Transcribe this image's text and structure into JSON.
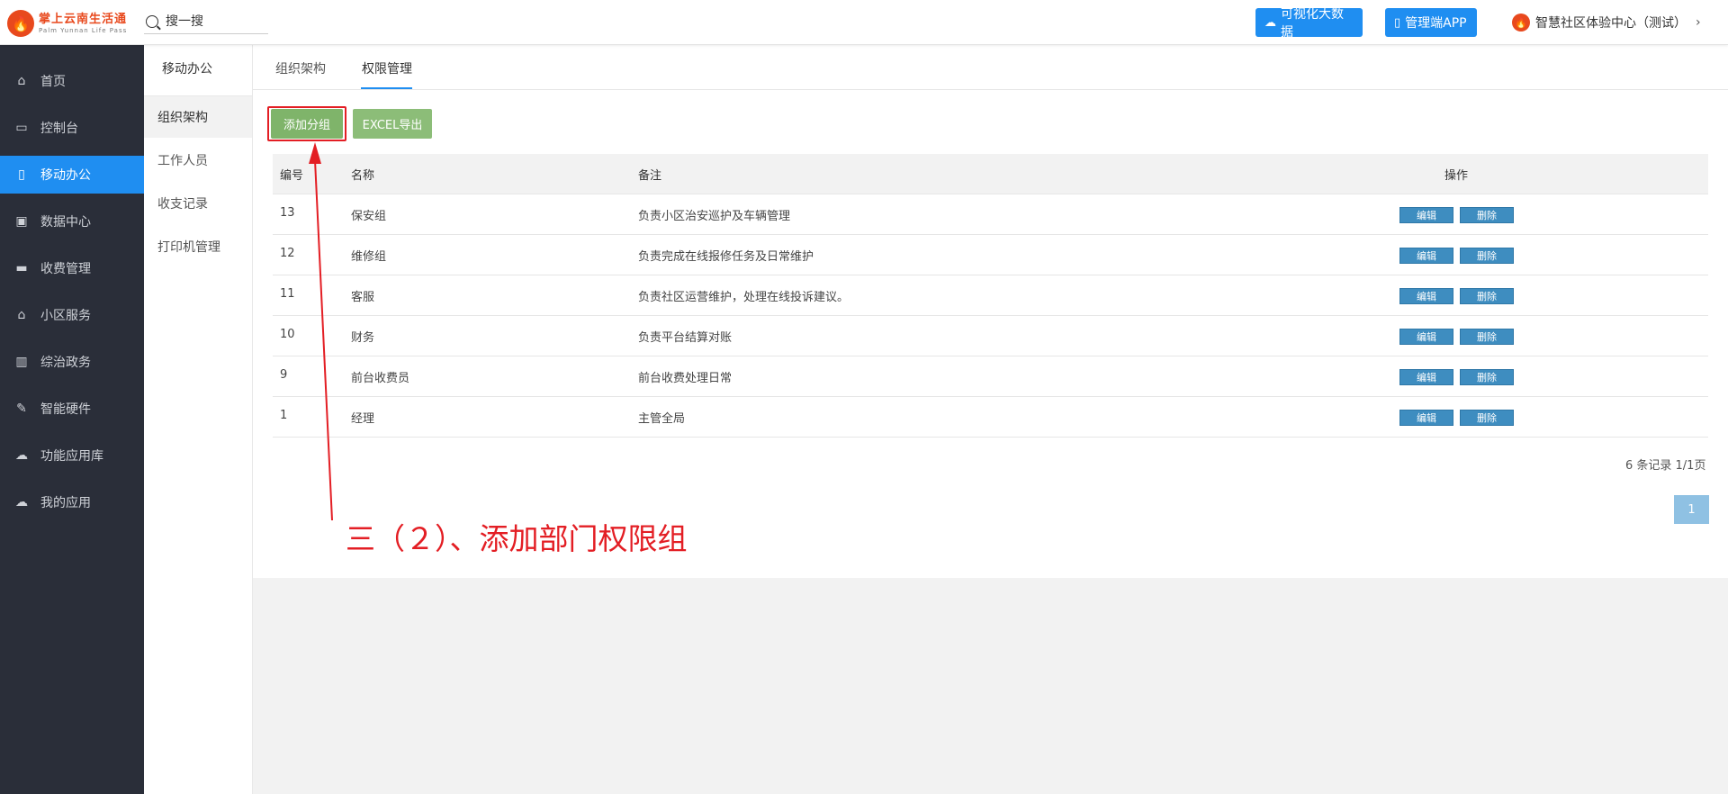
{
  "header": {
    "logo_cn": "掌上云南生活通",
    "logo_en": "Palm Yunnan Life Pass",
    "search_placeholder": "搜一搜",
    "btn_bigdata": "可视化大数据",
    "btn_app": "管理端APP",
    "community": "智慧社区体验中心（测试）"
  },
  "sidebar": {
    "items": [
      {
        "label": "首页",
        "icon": "home-icon"
      },
      {
        "label": "控制台",
        "icon": "laptop-icon"
      },
      {
        "label": "移动办公",
        "icon": "mobile-icon"
      },
      {
        "label": "数据中心",
        "icon": "briefcase-icon"
      },
      {
        "label": "收费管理",
        "icon": "credit-card-icon"
      },
      {
        "label": "小区服务",
        "icon": "home-icon"
      },
      {
        "label": "综治政务",
        "icon": "bank-icon"
      },
      {
        "label": "智能硬件",
        "icon": "wrench-icon"
      },
      {
        "label": "功能应用库",
        "icon": "cloud-download-icon"
      },
      {
        "label": "我的应用",
        "icon": "cloud-icon"
      }
    ],
    "active_index": 2
  },
  "submenu": {
    "title": "移动办公",
    "items": [
      "组织架构",
      "工作人员",
      "收支记录",
      "打印机管理"
    ]
  },
  "tabs": [
    "组织架构",
    "权限管理"
  ],
  "toolbar": {
    "add_label": "添加分组",
    "excel_label": "EXCEL导出"
  },
  "table": {
    "headers": [
      "编号",
      "名称",
      "备注",
      "操作"
    ],
    "edit_label": "编辑",
    "delete_label": "删除",
    "rows": [
      {
        "id": "13",
        "name": "保安组",
        "note": "负责小区治安巡护及车辆管理"
      },
      {
        "id": "12",
        "name": "维修组",
        "note": "负责完成在线报修任务及日常维护"
      },
      {
        "id": "11",
        "name": "客服",
        "note": "负责社区运营维护，处理在线投诉建议。"
      },
      {
        "id": "10",
        "name": "财务",
        "note": "负责平台结算对账"
      },
      {
        "id": "9",
        "name": "前台收费员",
        "note": "前台收费处理日常"
      },
      {
        "id": "1",
        "name": "经理",
        "note": "主管全局"
      }
    ]
  },
  "pagination": {
    "records": "6 条记录 1/1页",
    "current_page": "1"
  },
  "annotation": {
    "text": "三（２）、添加部门权限组",
    "color": "#e31e24"
  },
  "colors": {
    "accent": "#1f8ef1",
    "sidebar_bg": "#2a2e39",
    "green_button": "#7fb46a",
    "row_button": "#3e8dc0"
  }
}
